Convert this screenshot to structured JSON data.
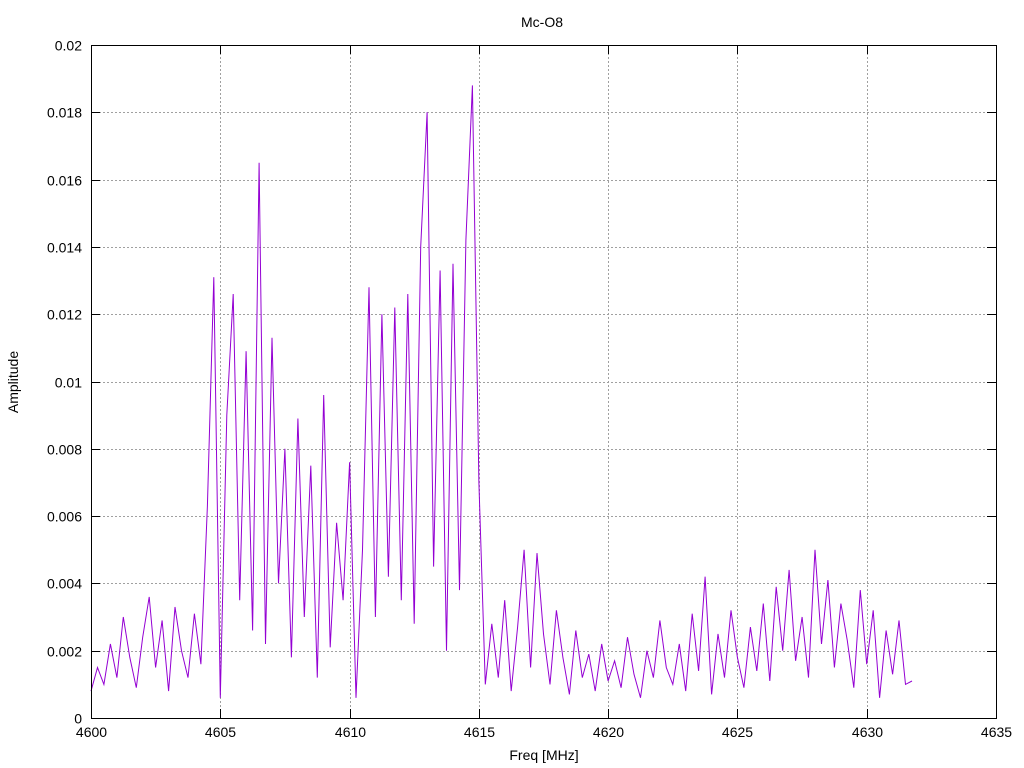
{
  "chart_data": {
    "type": "line",
    "title": "Mc-O8",
    "xlabel": "Freq [MHz]",
    "ylabel": "Amplitude",
    "xlim": [
      4600,
      4635
    ],
    "ylim": [
      0,
      0.02
    ],
    "xticks": [
      "4600",
      "4605",
      "4610",
      "4615",
      "4620",
      "4625",
      "4630",
      "4635"
    ],
    "yticks": [
      "0",
      "0.002",
      "0.004",
      "0.006",
      "0.008",
      "0.01",
      "0.012",
      "0.014",
      "0.016",
      "0.018",
      "0.02"
    ],
    "grid": true,
    "legend": "none",
    "series": [
      {
        "name": "Mc-O8",
        "color": "#9400d3",
        "x_start": 4600,
        "x_step": 0.25,
        "values": [
          0.0008,
          0.0015,
          0.001,
          0.0022,
          0.0012,
          0.003,
          0.0018,
          0.0009,
          0.0024,
          0.0036,
          0.0015,
          0.0029,
          0.0008,
          0.0033,
          0.002,
          0.0012,
          0.0031,
          0.0016,
          0.0063,
          0.0131,
          0.0006,
          0.009,
          0.0126,
          0.0035,
          0.0109,
          0.0026,
          0.0165,
          0.0022,
          0.0113,
          0.004,
          0.008,
          0.0018,
          0.0089,
          0.003,
          0.0075,
          0.0012,
          0.0096,
          0.0021,
          0.0058,
          0.0035,
          0.0076,
          0.0006,
          0.005,
          0.0128,
          0.003,
          0.012,
          0.0042,
          0.0122,
          0.0035,
          0.0126,
          0.0028,
          0.014,
          0.018,
          0.0045,
          0.0133,
          0.002,
          0.0135,
          0.0038,
          0.0142,
          0.0188,
          0.007,
          0.001,
          0.0028,
          0.0012,
          0.0035,
          0.0008,
          0.0027,
          0.005,
          0.0015,
          0.0049,
          0.0025,
          0.001,
          0.0032,
          0.0018,
          0.0007,
          0.0026,
          0.0012,
          0.0019,
          0.0008,
          0.0022,
          0.0011,
          0.0017,
          0.0009,
          0.0024,
          0.0013,
          0.0006,
          0.002,
          0.0012,
          0.0029,
          0.0015,
          0.001,
          0.0022,
          0.0008,
          0.0031,
          0.0014,
          0.0042,
          0.0007,
          0.0025,
          0.0012,
          0.0032,
          0.0018,
          0.0009,
          0.0027,
          0.0014,
          0.0034,
          0.0011,
          0.0039,
          0.002,
          0.0044,
          0.0017,
          0.003,
          0.0012,
          0.005,
          0.0022,
          0.0041,
          0.0015,
          0.0034,
          0.0023,
          0.0009,
          0.0038,
          0.0016,
          0.0032,
          0.0006,
          0.0026,
          0.0013,
          0.0029,
          0.001,
          0.0011
        ]
      }
    ]
  }
}
